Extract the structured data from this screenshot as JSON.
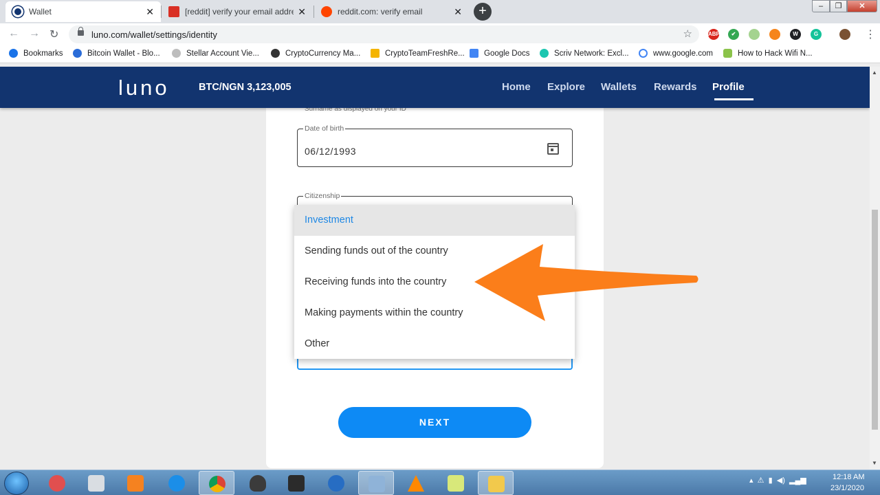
{
  "browser": {
    "tabs": [
      {
        "title": "Wallet",
        "favicon": "luno-icon",
        "color": "#12346f"
      },
      {
        "title": "[reddit] verify your email address",
        "favicon": "gmail-icon",
        "color": "#d93025"
      },
      {
        "title": "reddit.com: verify email",
        "favicon": "reddit-icon",
        "color": "#ff4500"
      }
    ],
    "new_tab": "+",
    "window_controls": [
      "–",
      "❐",
      "✕"
    ],
    "url": "luno.com/wallet/settings/identity",
    "extensions": [
      "ABP",
      "✔",
      "",
      "",
      "W",
      "G",
      ""
    ],
    "bookmarks": [
      "Bookmarks",
      "Bitcoin Wallet - Blo...",
      "Stellar Account Vie...",
      "CryptoCurrency Ma...",
      "CryptoTeamFreshRe...",
      "Google Docs",
      "Scriv Network: Excl...",
      "www.google.com",
      "How to Hack Wifi N..."
    ]
  },
  "luno": {
    "logo": "LUNO",
    "ticker": "BTC/NGN 3,123,005",
    "nav": [
      "Home",
      "Explore",
      "Wallets",
      "Rewards",
      "Profile"
    ],
    "active_nav": "Profile",
    "brand_color": "#12346f"
  },
  "form": {
    "surname_help": "Surname as displayed on your ID",
    "dob_label": "Date of birth",
    "dob_value": "06/12/1993",
    "citizenship_label": "Citizenship",
    "purpose_options": [
      "Investment",
      "Sending funds out of the country",
      "Receiving funds into the country",
      "Making payments within the country",
      "Other"
    ],
    "selected_option": "Investment",
    "next_label": "NEXT",
    "accent_color": "#0d8af5"
  },
  "annotation": {
    "arrow_color": "#fb7e1a"
  },
  "taskbar": {
    "apps": [
      "scissors-icon",
      "calculator-icon",
      "media-player-icon",
      "internet-explorer-icon",
      "chrome-icon",
      "inkscape-icon",
      "nox-icon",
      "r-icon",
      "paint-icon",
      "vlc-icon",
      "notes-icon",
      "file-explorer-icon"
    ],
    "time": "12:18 AM",
    "date": "23/1/2020"
  }
}
